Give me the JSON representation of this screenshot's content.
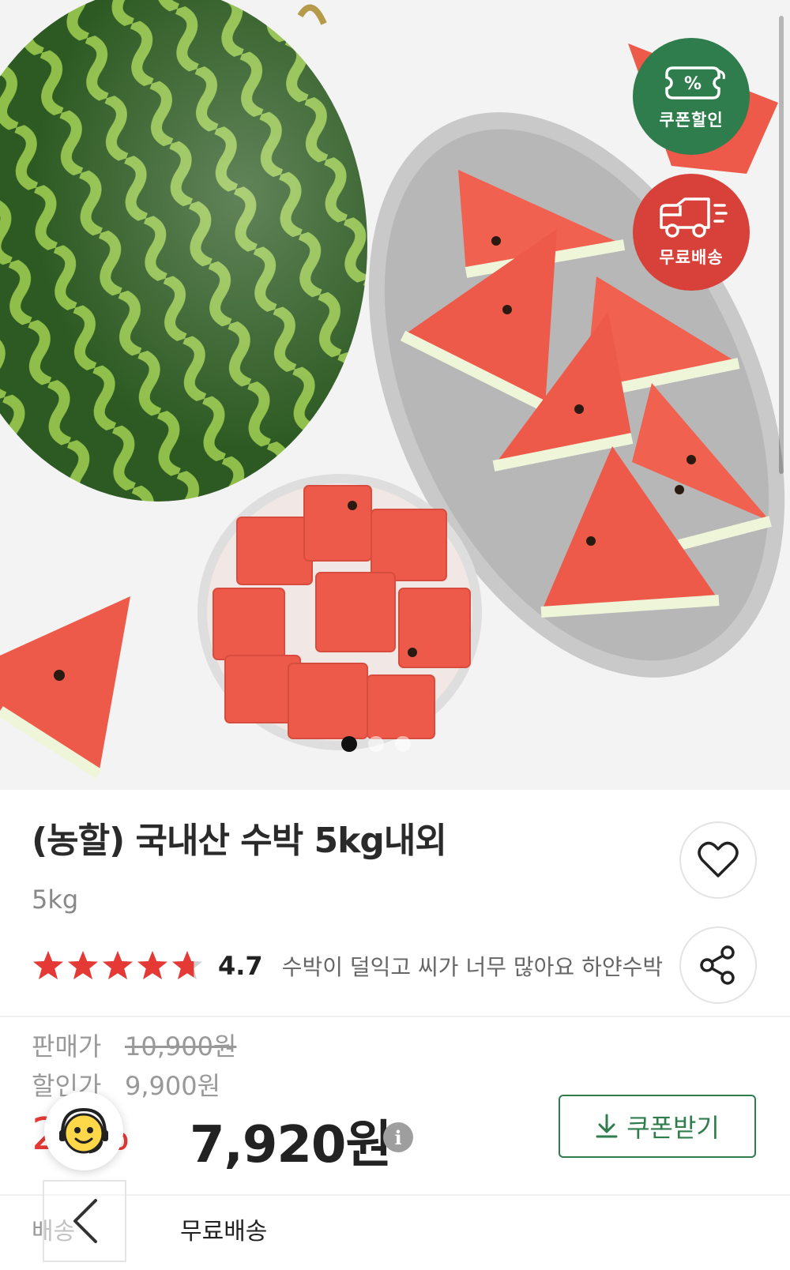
{
  "hero": {
    "badges": [
      {
        "label": "쿠폰할인",
        "icon": "percent-ticket-icon",
        "color": "#2f7d4c"
      },
      {
        "label": "무료배송",
        "icon": "delivery-truck-icon",
        "color": "#d8413a"
      }
    ],
    "carousel": {
      "active_index": 0,
      "count": 3
    }
  },
  "product": {
    "title": "(농할) 국내산 수박 5kg내외",
    "option": "5kg",
    "rating": {
      "value": "4.7",
      "stars": 4.7,
      "max": 5,
      "review_snippet": "수박이 덜익고 씨가 너무 많아요 하얀수박"
    }
  },
  "actions": {
    "like_icon": "heart-icon",
    "share_icon": "share-icon"
  },
  "pricing": {
    "sale_label": "판매가",
    "sale_price": "10,900원",
    "discount_label": "할인가",
    "discount_price": "9,900원",
    "discount_rate": "27%",
    "final_price": "7,920원",
    "info_glyph": "i",
    "coupon_button": "쿠폰받기"
  },
  "delivery": {
    "label": "배송",
    "value": "무료배송"
  },
  "colors": {
    "brand_green": "#2f7d4c",
    "sale_red": "#e53935",
    "shipping_red": "#d8413a",
    "star_red": "#e53935"
  }
}
